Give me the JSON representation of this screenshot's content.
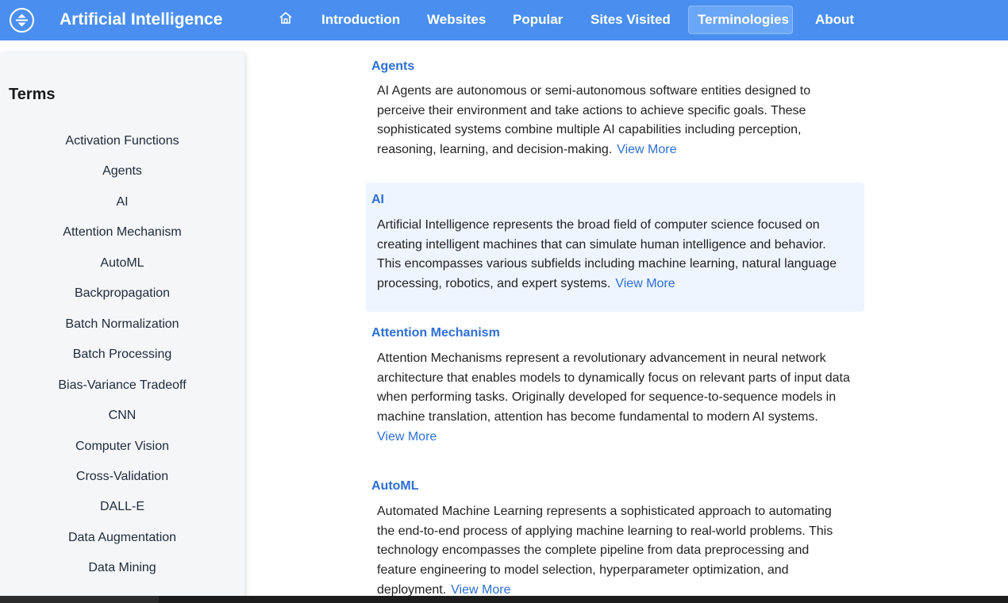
{
  "header": {
    "brand": "Artificial Intelligence",
    "logo_icon": "expand-collapse-circle-icon",
    "home_icon": "home-icon",
    "nav": [
      {
        "label": "Introduction"
      },
      {
        "label": "Websites"
      },
      {
        "label": "Popular"
      },
      {
        "label": "Sites Visited"
      },
      {
        "label": "Terminologies",
        "active": true
      },
      {
        "label": "About"
      }
    ],
    "colors": {
      "bar": "#4a8ff0",
      "active": "#6aa6f7"
    }
  },
  "sidebar": {
    "title": "Terms",
    "items": [
      {
        "label": "Activation Functions"
      },
      {
        "label": "Agents"
      },
      {
        "label": "AI"
      },
      {
        "label": "Attention Mechanism"
      },
      {
        "label": "AutoML"
      },
      {
        "label": "Backpropagation"
      },
      {
        "label": "Batch Normalization"
      },
      {
        "label": "Batch Processing"
      },
      {
        "label": "Bias-Variance Tradeoff"
      },
      {
        "label": "CNN"
      },
      {
        "label": "Computer Vision"
      },
      {
        "label": "Cross-Validation"
      },
      {
        "label": "DALL-E"
      },
      {
        "label": "Data Augmentation"
      },
      {
        "label": "Data Mining"
      }
    ]
  },
  "terms": [
    {
      "title": "Agents",
      "lines": [
        "AI Agents are autonomous or semi-autonomous software entities designed to",
        "perceive their environment and take actions to achieve specific goals. These",
        "sophisticated systems combine multiple AI capabilities including perception,",
        "reasoning, learning, and decision-making."
      ],
      "link": "View More"
    },
    {
      "title": "AI",
      "lines": [
        "Artificial Intelligence represents the broad field of computer science focused on",
        "creating intelligent machines that can simulate human intelligence and behavior.",
        "This encompasses various subfields including machine learning, natural language",
        "processing, robotics, and expert systems."
      ],
      "link": "View More"
    },
    {
      "title": "Attention Mechanism",
      "lines": [
        "Attention Mechanisms represent a revolutionary advancement in neural network",
        "architecture that enables models to dynamically focus on relevant parts of input data",
        "when performing tasks. Originally developed for sequence-to-sequence models in",
        "machine translation, attention has become fundamental to modern AI systems."
      ],
      "link": "View More"
    },
    {
      "title": "AutoML",
      "lines": [
        "Automated Machine Learning represents a sophisticated approach to automating",
        "the end-to-end process of applying machine learning to real-world problems. This",
        "technology encompasses the complete pipeline from data preprocessing and",
        "feature engineering to model selection, hyperparameter optimization, and",
        "deployment."
      ],
      "link": "View More"
    }
  ],
  "colors": {
    "link": "#2d6fd6",
    "highlight": "#eef5fe",
    "sidebar": "#f5f6f8"
  }
}
